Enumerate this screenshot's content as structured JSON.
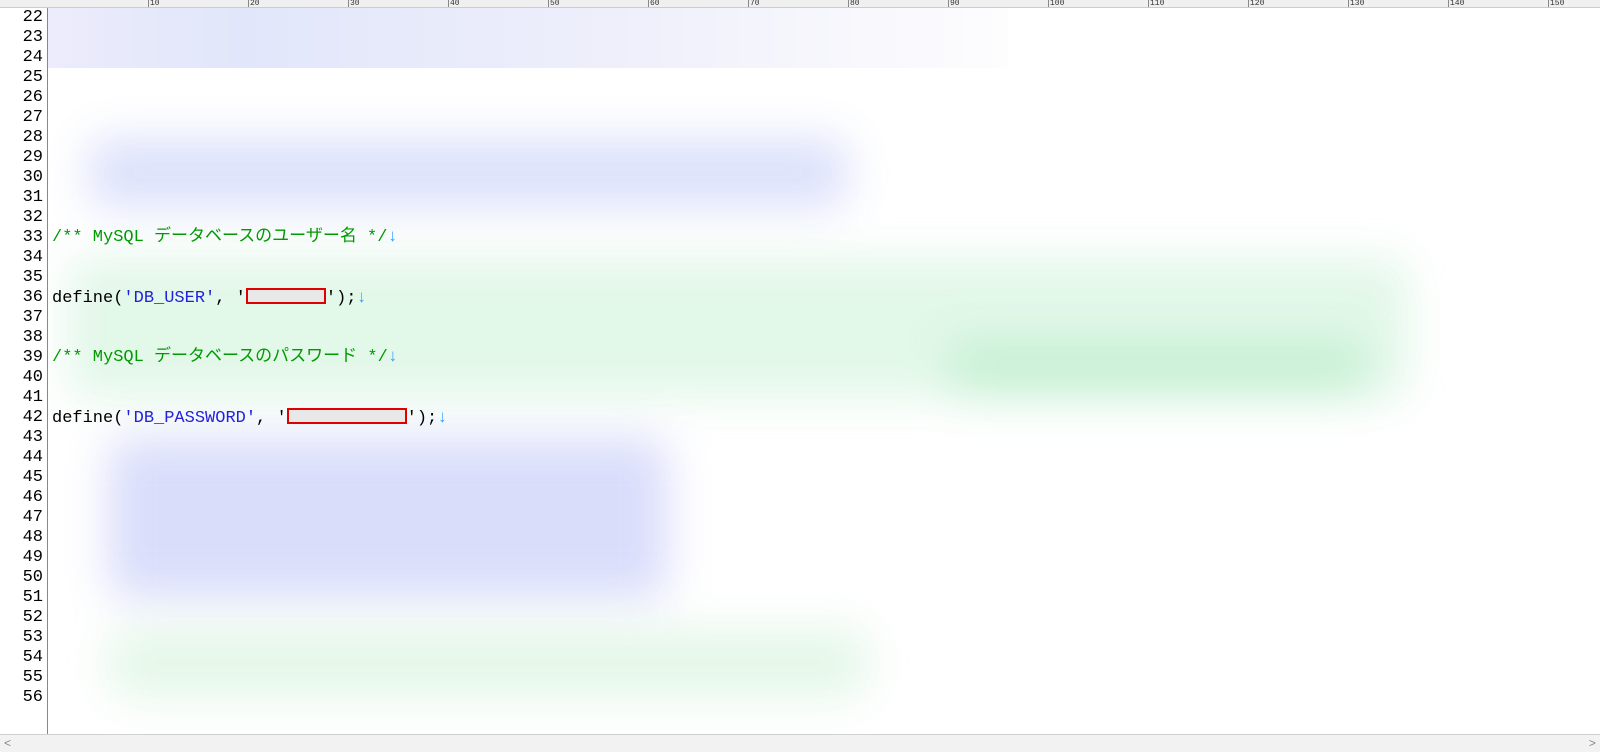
{
  "gutter": {
    "start": 22,
    "end": 56
  },
  "ruler": {
    "major_step": 10,
    "max": 150
  },
  "code": {
    "comment_user": "/** MySQL データベースのユーザー名 */",
    "comment_pass": "/** MySQL データベースのパスワード */",
    "define_kw": "define",
    "db_user_key": "'DB_USER'",
    "db_pass_key": "'DB_PASSWORD'",
    "comma_space": ", ",
    "quote_open": "'",
    "quote_close": "'",
    "stmt_end": ");",
    "newline_mark": "↓"
  },
  "scroll": {
    "left_arrow": "<",
    "right_arrow": ">"
  }
}
